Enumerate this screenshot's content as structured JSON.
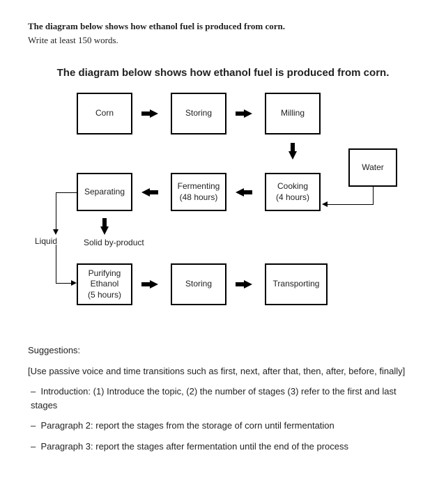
{
  "task": {
    "title": "The diagram below shows how ethanol fuel is produced from corn.",
    "subtitle": "Write at least 150 words."
  },
  "diagram": {
    "title": "The diagram below shows how ethanol fuel is produced from corn.",
    "boxes": {
      "corn": "Corn",
      "storing1": "Storing",
      "milling": "Milling",
      "water": "Water",
      "cooking": "Cooking\n(4 hours)",
      "fermenting": "Fermenting\n(48 hours)",
      "separating": "Separating",
      "purifying": "Purifying\nEthanol\n(5 hours)",
      "storing2": "Storing",
      "transporting": "Transporting"
    },
    "labels": {
      "liquid": "Liquid",
      "solid": "Solid by-product"
    }
  },
  "suggestions": {
    "heading": "Suggestions:",
    "note": "[Use passive voice and time transitions such as first, next, after that, then, after, before, finally]",
    "items": [
      "Introduction: (1) Introduce the topic, (2) the number of stages (3) refer to the first and last stages",
      "Paragraph 2: report the stages from the storage of corn until fermentation",
      "Paragraph 3: report the stages after fermentation until the end of the process"
    ]
  }
}
